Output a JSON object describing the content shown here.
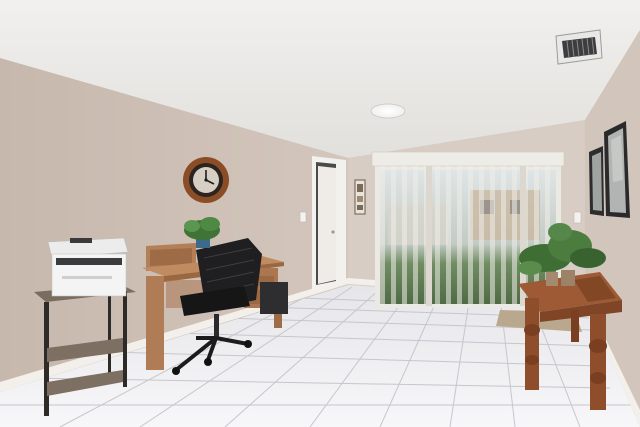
{
  "scene": {
    "description_visible_text": [],
    "colors": {
      "ceiling": "#ecebe8",
      "left_wall": "#cdbfb4",
      "back_wall": "#d8cdc4",
      "right_wall": "#d4c8bf",
      "floor_tile": "#f2f2f4",
      "grout": "#c9c9cf",
      "baseboard": "#f4f2ef",
      "desk_wood": "#b07c55",
      "console_wood": "#9c5a35",
      "chair": "#1d1d1f",
      "door": "#f1efeb",
      "blind": "#ecebe6",
      "yard_green": "#5e7d52",
      "plant_green": "#3f6e35",
      "printer": "#f3f3f3"
    },
    "objects": [
      "ceiling-light",
      "air-vent",
      "wall-clock",
      "printer-shelf",
      "printer",
      "desk",
      "office-chair",
      "potted-plant",
      "interior-door",
      "framed-wall-art",
      "sliding-glass-door",
      "vertical-blinds",
      "console-table",
      "console-plant",
      "framed-mirror-left",
      "framed-mirror-right",
      "door-mat"
    ]
  }
}
